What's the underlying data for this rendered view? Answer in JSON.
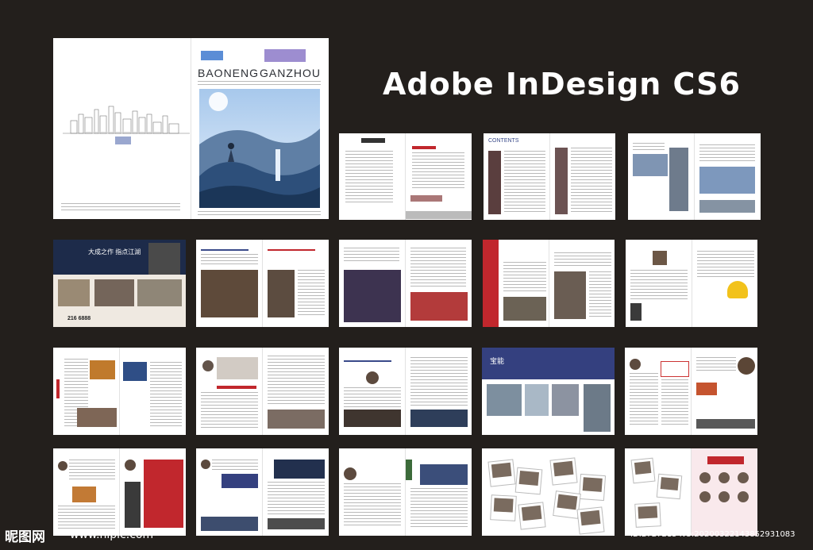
{
  "heading": "Adobe InDesign CS6",
  "cover": {
    "brand_latin_left": "BAONENG",
    "brand_latin_right": "GANZHOU"
  },
  "spreads": {
    "ad_headline": "大成之作 指点江湖",
    "ad_phone": "216 6888",
    "contents_label": "CONTENTS",
    "logo_text": "宝能"
  },
  "watermark": {
    "site_name": "昵图网",
    "url": "www.nipic.com",
    "id_line": "ID:2727215 NO:20200322143852931083"
  },
  "colors": {
    "background": "#231f1c",
    "accent_red": "#c1272d",
    "accent_blue": "#34407f"
  }
}
